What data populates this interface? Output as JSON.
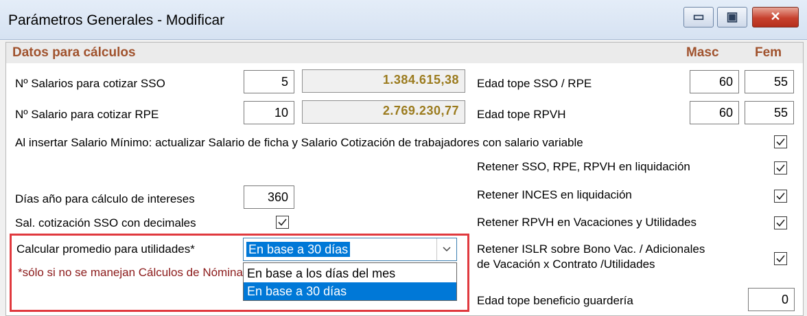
{
  "window": {
    "title": "Parámetros Generales - Modificar",
    "controls": {
      "minimize_icon": "minimize-icon",
      "maximize_icon": "maximize-icon",
      "close_icon": "close-icon"
    }
  },
  "section": {
    "title": "Datos para cálculos",
    "col_masc": "Masc",
    "col_fem": "Fem"
  },
  "fields": {
    "salarios_sso_label": "Nº Salarios para cotizar SSO",
    "salarios_sso_value": "5",
    "salarios_sso_amount": "1.384.615,38",
    "salario_rpe_label": "Nº Salario para cotizar RPE",
    "salario_rpe_value": "10",
    "salario_rpe_amount": "2.769.230,77",
    "edad_sso_label": "Edad tope SSO / RPE",
    "edad_sso_masc": "60",
    "edad_sso_fem": "55",
    "edad_rpvh_label": "Edad tope RPVH",
    "edad_rpvh_masc": "60",
    "edad_rpvh_fem": "55",
    "salario_minimo_label": "Al insertar Salario Mínimo: actualizar Salario de ficha y Salario Cotización de trabajadores con  salario variable",
    "dias_anio_label": "Días año para cálculo de intereses",
    "dias_anio_value": "360",
    "sal_decimales_label": "Sal. cotización SSO con decimales",
    "retener_sso_label": "Retener SSO, RPE, RPVH en liquidación",
    "retener_inces_label": "Retener INCES en liquidación",
    "retener_rpvh_label": "Retener RPVH en Vacaciones y Utilidades",
    "retener_islr_line1": "Retener ISLR sobre Bono Vac. / Adicionales",
    "retener_islr_line2": "de Vacación x Contrato /Utilidades",
    "edad_guarderia_label": "Edad tope beneficio guardería",
    "edad_guarderia_value": "0",
    "promedio_label": "Calcular promedio para utilidades*",
    "promedio_note": "*sólo si no se manejan Cálculos de Nómina",
    "promedio_selected": "En base a 30 días",
    "promedio_options": [
      "En base a los días del mes",
      "En base a 30 días"
    ]
  },
  "checkboxes": {
    "salario_minimo": true,
    "sal_decimales": true,
    "retener_sso": true,
    "retener_inces": true,
    "retener_rpvh": true,
    "retener_islr": true
  }
}
